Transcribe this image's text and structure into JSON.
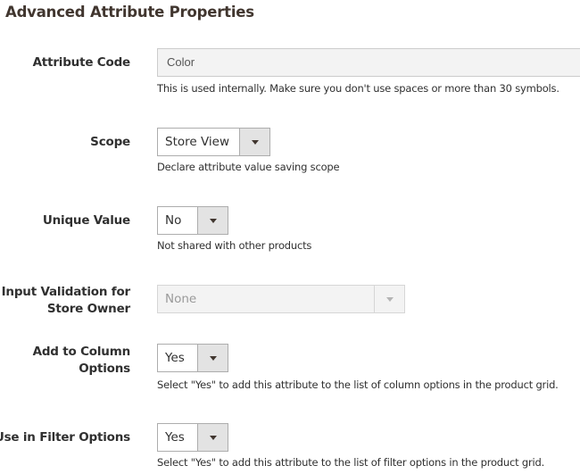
{
  "section": {
    "title": "Advanced Attribute Properties"
  },
  "fields": {
    "attribute_code": {
      "label": "Attribute Code",
      "value": "Color",
      "note": "This is used internally. Make sure you don't use spaces or more than 30 symbols."
    },
    "scope": {
      "label": "Scope",
      "value": "Store View",
      "note": "Declare attribute value saving scope"
    },
    "unique_value": {
      "label": "Unique Value",
      "value": "No",
      "note": "Not shared with other products"
    },
    "input_validation": {
      "label_line1": "Input Validation for",
      "label_line2": "Store Owner",
      "value": "None",
      "disabled": true
    },
    "add_to_column_options": {
      "label_line1": "Add to Column",
      "label_line2": "Options",
      "value": "Yes",
      "note": "Select \"Yes\" to add this attribute to the list of column options in the product grid."
    },
    "use_in_filter_options": {
      "label": "Use in Filter Options",
      "value": "Yes",
      "note": "Select \"Yes\" to add this attribute to the list of filter options in the product grid."
    }
  }
}
